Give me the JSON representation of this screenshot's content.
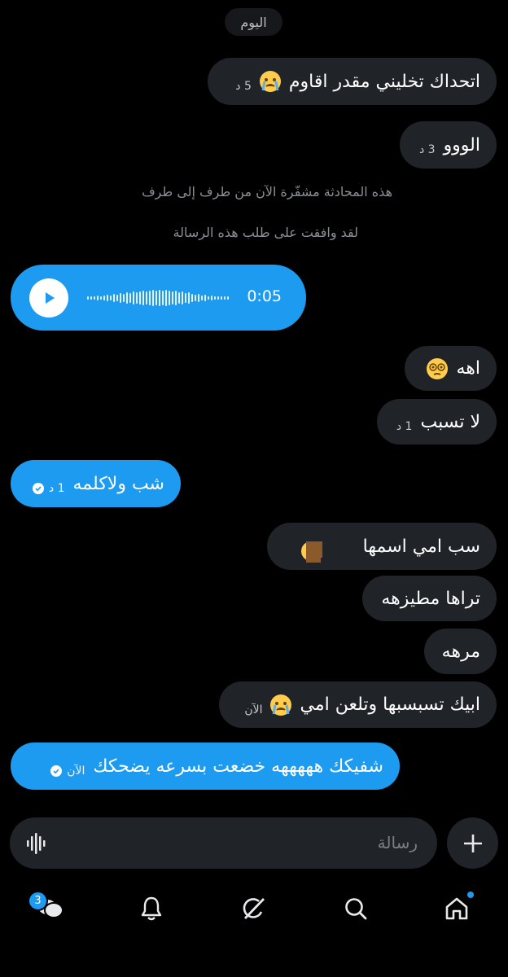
{
  "day_label": "اليوم",
  "messages": [
    {
      "text": "اتحداك تخليني مقدر اقاوم",
      "emoji": "loudly-crying-face",
      "time": "5 د",
      "direction": "received"
    },
    {
      "text": "الووو",
      "time": "3 د",
      "direction": "received"
    },
    {
      "text": "اهه",
      "emoji": "dizzy-face",
      "direction": "received"
    },
    {
      "text": "لا تسبب",
      "time": "1 د",
      "direction": "received"
    },
    {
      "text": "شب ولاكلمه",
      "time": "1 د",
      "direction": "sent"
    },
    {
      "text": "سب امي اسمها",
      "emoji": "crying-face-sticker",
      "direction": "received"
    },
    {
      "text": "تراها مطيزهه",
      "direction": "received"
    },
    {
      "text": "مرهه",
      "direction": "received"
    },
    {
      "text": "ابيك تسبسبها وتلعن امي",
      "emoji": "loudly-crying-face",
      "time": "الآن",
      "direction": "received"
    },
    {
      "text": "شفيكك هههههه خضعت بسرعه يضحكك",
      "time": "الآن",
      "direction": "sent"
    }
  ],
  "system": {
    "encrypted": "هذه المحادثة مشفّرة الآن من طرف إلى طرف",
    "accepted": "لقد وافقت على طلب هذه الرسالة"
  },
  "voice": {
    "duration": "0:05",
    "icon": "play-icon"
  },
  "composer": {
    "placeholder": "رسالة",
    "mic_icon": "voice-wave-icon",
    "add_icon": "plus-icon"
  },
  "nav": {
    "messages_badge": "3",
    "items": [
      "messages-icon",
      "bell-icon",
      "grok-icon",
      "search-icon",
      "home-icon"
    ]
  },
  "colors": {
    "accent": "#1d9bf0",
    "bubble_received": "#202327",
    "background": "#000000"
  }
}
